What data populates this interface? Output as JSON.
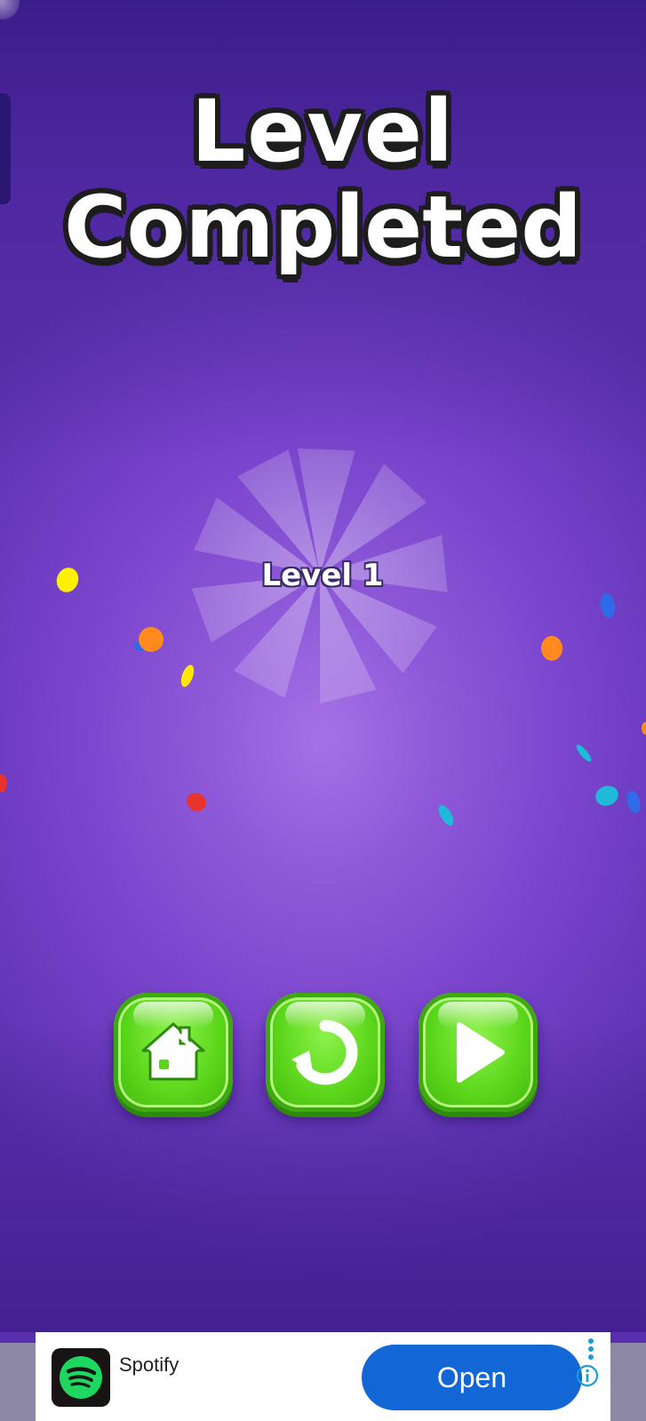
{
  "title": {
    "line1": "Level",
    "line2": "Completed"
  },
  "level_label": "Level 1",
  "buttons": {
    "home_icon": "home-icon",
    "replay_icon": "replay-icon",
    "next_icon": "play-icon"
  },
  "ad": {
    "app_name": "Spotify",
    "cta_label": "Open",
    "logo_icon": "spotify-logo-icon",
    "menu_icon": "more-vert-icon",
    "info_icon": "info-icon"
  },
  "colors": {
    "background": "#8f5ad9",
    "button_green": "#5bd61b",
    "ad_cta": "#1366d6",
    "spotify_green": "#1ed760"
  }
}
